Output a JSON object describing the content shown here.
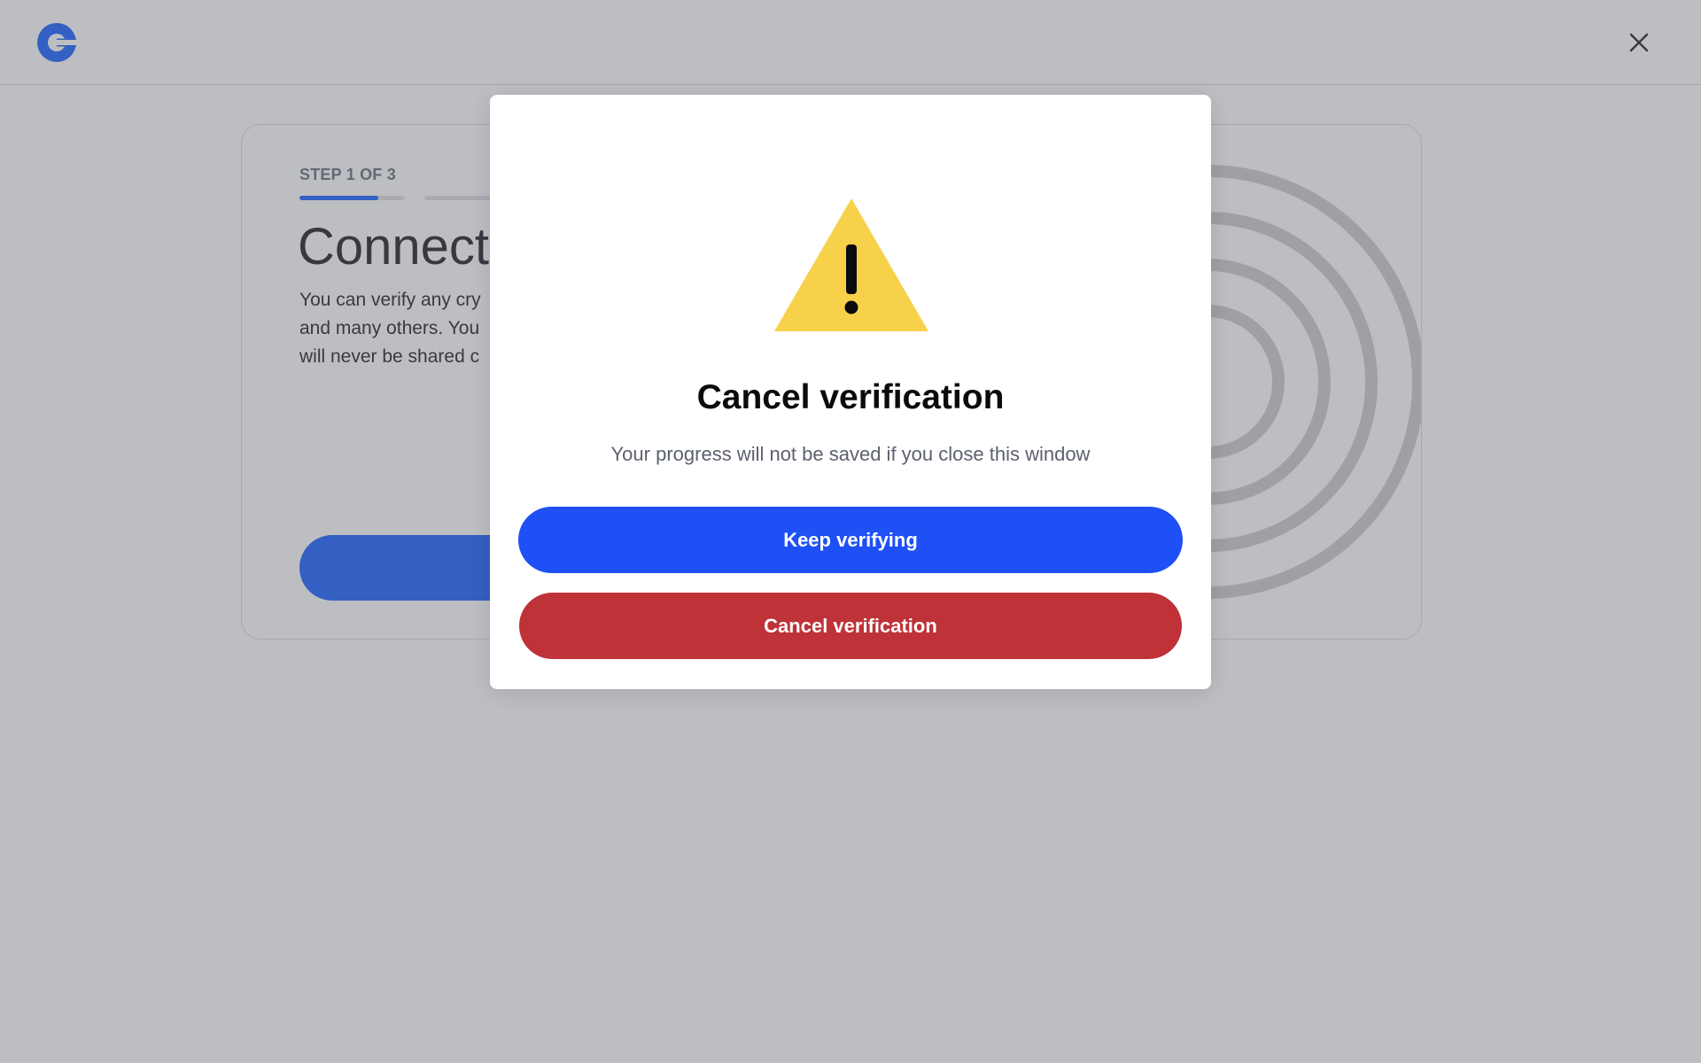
{
  "page": {
    "logo_name": "coinbase-logo",
    "close_icon": "close-icon"
  },
  "card": {
    "step_label": "STEP 1 OF 3",
    "progress": {
      "total_steps": 3,
      "current_step": 1,
      "current_fill_fraction": 0.75
    },
    "title": "Connect",
    "body_lines": [
      "You can verify any cry",
      "and many others. You",
      "will never be shared c"
    ]
  },
  "modal": {
    "icon": "warning-icon",
    "title": "Cancel verification",
    "description": "Your progress will not be saved if you close this window",
    "primary_button": "Keep verifying",
    "secondary_button": "Cancel verification"
  },
  "colors": {
    "brand_blue": "#1e50f5",
    "danger_red": "#be3238",
    "warning_yellow": "#f7d14a",
    "text_primary": "#0a0b0d",
    "text_secondary": "#5b616e"
  }
}
